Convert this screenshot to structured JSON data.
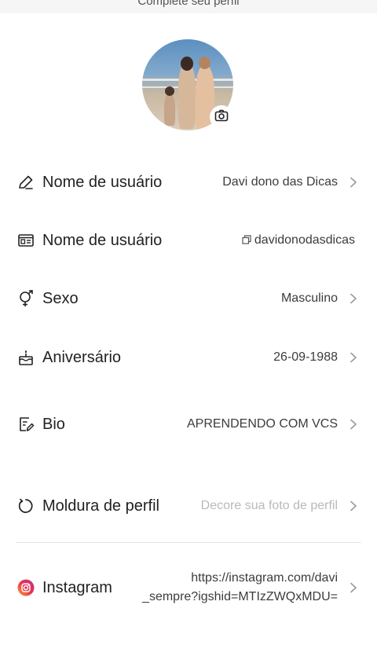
{
  "header": {
    "title": "Complete seu perfil"
  },
  "profile": {
    "camera_icon": "camera-icon"
  },
  "fields": {
    "display_name": {
      "label": "Nome de usuário",
      "value": "Davi dono das Dicas",
      "icon": "pencil-icon"
    },
    "username": {
      "label": "Nome de usuário",
      "value": "davidonodasdicas",
      "icon": "id-card-icon",
      "copy_icon": "copy-icon"
    },
    "gender": {
      "label": "Sexo",
      "value": "Masculino",
      "icon": "gender-icon"
    },
    "birthday": {
      "label": "Aniversário",
      "value": "26-09-1988",
      "icon": "cake-icon"
    },
    "bio": {
      "label": "Bio",
      "value": "APRENDENDO COM VCS",
      "icon": "edit-note-icon"
    },
    "frame": {
      "label": "Moldura de perfil",
      "placeholder": "Decore sua foto de perfil",
      "icon": "refresh-circle-icon"
    },
    "instagram": {
      "label": "Instagram",
      "value_line1": "https://instagram.com/davi",
      "value_line2": "_sempre?igshid=MTIzZWQxMDU=",
      "icon": "instagram-icon"
    }
  },
  "colors": {
    "instagram_gradient_start": "#f9a23c",
    "instagram_gradient_end": "#c42d8f",
    "chevron": "#9a9a9a",
    "placeholder": "#b9b9b9"
  }
}
